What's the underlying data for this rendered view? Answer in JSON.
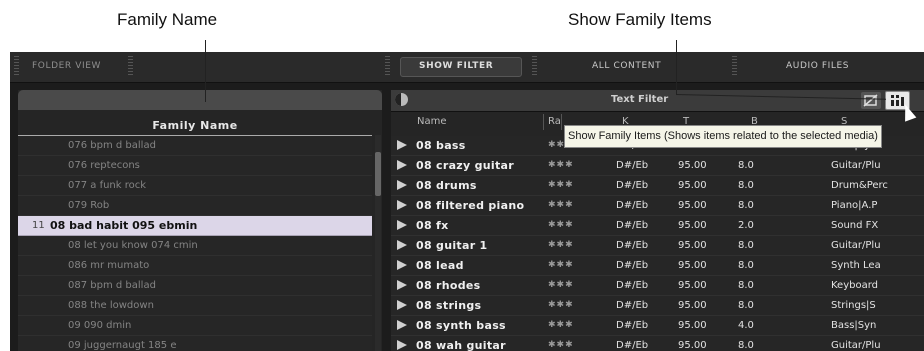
{
  "callouts": {
    "family_name": "Family Name",
    "show_family_items": "Show Family Items"
  },
  "topbar": {
    "folder_view": "FOLDER VIEW",
    "show_filter": "SHOW FILTER",
    "all_content": "ALL CONTENT",
    "audio_files": "AUDIO FILES"
  },
  "left_panel": {
    "column_header": "Family Name",
    "families": [
      {
        "count": "",
        "name": "076 bpm d ballad"
      },
      {
        "count": "",
        "name": "076 reptecons"
      },
      {
        "count": "",
        "name": "077 a funk rock"
      },
      {
        "count": "",
        "name": "079 Rob"
      },
      {
        "count": "11",
        "name": "08 bad habit 095 ebmin",
        "selected": true
      },
      {
        "count": "",
        "name": "08 let you know 074 cmin"
      },
      {
        "count": "",
        "name": "086 mr mumato"
      },
      {
        "count": "",
        "name": "087 bpm d ballad"
      },
      {
        "count": "",
        "name": "088 the lowdown"
      },
      {
        "count": "",
        "name": "09 090 dmin"
      },
      {
        "count": "",
        "name": "09 juggernaugt 185 e"
      }
    ]
  },
  "right_panel": {
    "filter_label": "Text Filter",
    "columns": [
      "Name",
      "Ra",
      "K",
      "T",
      "B",
      "S"
    ],
    "rows": [
      {
        "name": "08 bass",
        "rating": "✱✱✱",
        "key": "D#/Eb",
        "tempo": "95.00",
        "bars": "8.0",
        "category": "Bass|Syn"
      },
      {
        "name": "08 crazy guitar",
        "rating": "✱✱✱",
        "key": "D#/Eb",
        "tempo": "95.00",
        "bars": "8.0",
        "category": "Guitar/Plu"
      },
      {
        "name": "08 drums",
        "rating": "✱✱✱",
        "key": "D#/Eb",
        "tempo": "95.00",
        "bars": "8.0",
        "category": "Drum&Perc"
      },
      {
        "name": "08 filtered piano",
        "rating": "✱✱✱",
        "key": "D#/Eb",
        "tempo": "95.00",
        "bars": "8.0",
        "category": "Piano|A.P"
      },
      {
        "name": "08 fx",
        "rating": "✱✱✱",
        "key": "D#/Eb",
        "tempo": "95.00",
        "bars": "2.0",
        "category": "Sound FX"
      },
      {
        "name": "08 guitar 1",
        "rating": "✱✱✱",
        "key": "D#/Eb",
        "tempo": "95.00",
        "bars": "8.0",
        "category": "Guitar/Plu"
      },
      {
        "name": "08 lead",
        "rating": "✱✱✱",
        "key": "D#/Eb",
        "tempo": "95.00",
        "bars": "8.0",
        "category": "Synth Lea"
      },
      {
        "name": "08 rhodes",
        "rating": "✱✱✱",
        "key": "D#/Eb",
        "tempo": "95.00",
        "bars": "8.0",
        "category": "Keyboard"
      },
      {
        "name": "08 strings",
        "rating": "✱✱✱",
        "key": "D#/Eb",
        "tempo": "95.00",
        "bars": "8.0",
        "category": "Strings|S"
      },
      {
        "name": "08 synth bass",
        "rating": "✱✱✱",
        "key": "D#/Eb",
        "tempo": "95.00",
        "bars": "4.0",
        "category": "Bass|Syn"
      },
      {
        "name": "08 wah guitar",
        "rating": "✱✱✱",
        "key": "D#/Eb",
        "tempo": "95.00",
        "bars": "8.0",
        "category": "Guitar/Plu"
      }
    ]
  },
  "tooltip": "Show Family Items (Shows items related to the selected media)",
  "icons": [
    "contrast-toggle-icon",
    "hide-icon",
    "family-items-icon",
    "play-icon",
    "mouse-cursor-icon"
  ],
  "colors": {
    "selected_row": "#dcd6e8",
    "panel_bg": "#252525",
    "tooltip_bg": "#f5f5e8"
  }
}
